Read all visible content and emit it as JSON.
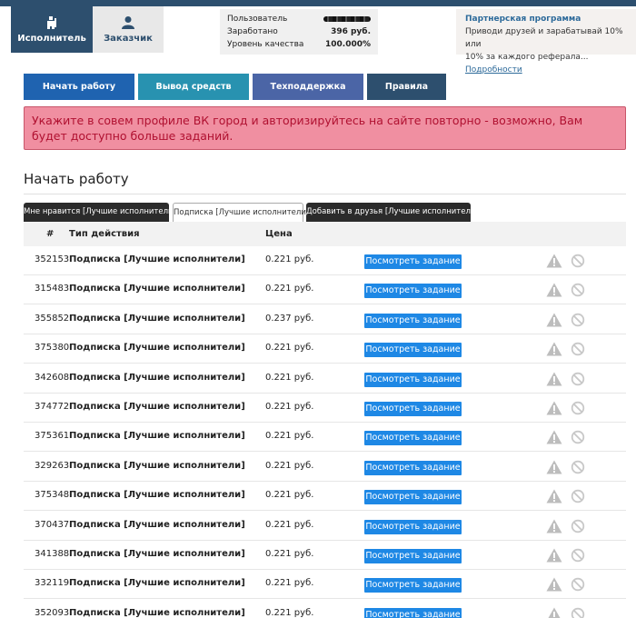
{
  "roles": {
    "executor": "Исполнитель",
    "customer": "Заказчик"
  },
  "stats": {
    "user_label": "Пользователь",
    "earned_label": "Заработано",
    "earned_value": "396 руб.",
    "quality_label": "Уровень качества",
    "quality_value": "100.000%"
  },
  "partner": {
    "title": "Партнерская программа",
    "text1": "Приводи друзей и зарабатывай 10% или",
    "text2": "10% за каждого реферала...",
    "link": "Подробности"
  },
  "nav": {
    "start": "Начать работу",
    "withdraw": "Вывод средств",
    "support": "Техподдержка",
    "rules": "Правила"
  },
  "alert": "Укажите в совем профиле ВК город и авторизируйтесь на сайте повторно - возможно, Вам будет доступно больше заданий.",
  "page_title": "Начать работу",
  "task_tabs": [
    "Мне нравится [Лучшие исполнители]",
    "Подписка [Лучшие исполнители]",
    "Добавить в друзья [Лучшие исполнители]"
  ],
  "table": {
    "col_num": "#",
    "col_type": "Тип действия",
    "col_price": "Цена",
    "button_label": "Посмотреть задание",
    "rows": [
      {
        "id": "352153",
        "type": "Подписка [Лучшие исполнители]",
        "price": "0.221 руб."
      },
      {
        "id": "315483",
        "type": "Подписка [Лучшие исполнители]",
        "price": "0.221 руб."
      },
      {
        "id": "355852",
        "type": "Подписка [Лучшие исполнители]",
        "price": "0.237 руб."
      },
      {
        "id": "375380",
        "type": "Подписка [Лучшие исполнители]",
        "price": "0.221 руб."
      },
      {
        "id": "342608",
        "type": "Подписка [Лучшие исполнители]",
        "price": "0.221 руб."
      },
      {
        "id": "374772",
        "type": "Подписка [Лучшие исполнители]",
        "price": "0.221 руб."
      },
      {
        "id": "375361",
        "type": "Подписка [Лучшие исполнители]",
        "price": "0.221 руб."
      },
      {
        "id": "329263",
        "type": "Подписка [Лучшие исполнители]",
        "price": "0.221 руб."
      },
      {
        "id": "375348",
        "type": "Подписка [Лучшие исполнители]",
        "price": "0.221 руб."
      },
      {
        "id": "370437",
        "type": "Подписка [Лучшие исполнители]",
        "price": "0.221 руб."
      },
      {
        "id": "341388",
        "type": "Подписка [Лучшие исполнители]",
        "price": "0.221 руб."
      },
      {
        "id": "332119",
        "type": "Подписка [Лучшие исполнители]",
        "price": "0.221 руб."
      },
      {
        "id": "352093",
        "type": "Подписка [Лучшие исполнители]",
        "price": "0.221 руб."
      }
    ]
  },
  "icons": {
    "executor": "worker-icon",
    "customer": "user-icon",
    "warning": "warning-icon",
    "block": "block-icon"
  },
  "colors": {
    "brand_dark": "#2d4f6e",
    "alert_bg": "#f08fa1",
    "alert_text": "#b01030",
    "button_blue": "#1e88e5"
  }
}
